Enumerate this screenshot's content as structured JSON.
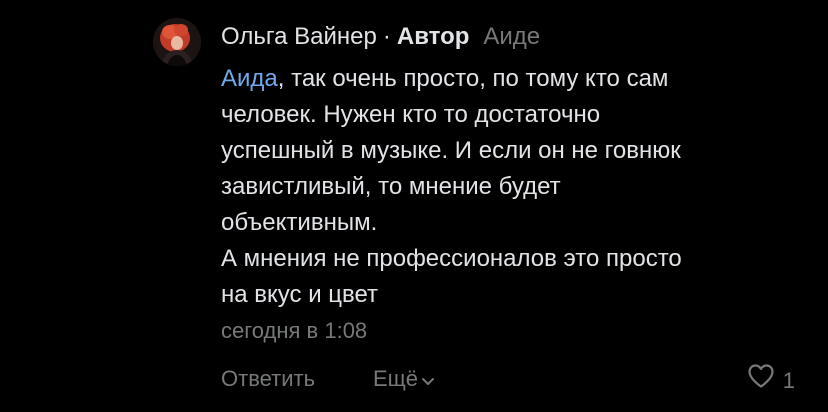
{
  "comment": {
    "author_name": "Ольга Вайнер",
    "separator": "·",
    "author_badge": "Автор",
    "reply_to": "Аиде",
    "mention": "Аида",
    "text_lines": [
      ", так очень просто, по тому кто сам",
      "человек. Нужен кто то достаточно",
      "успешный в музыке. И если он не говнюк",
      "завистливый, то мнение будет",
      "объективным.",
      "А мнения не профессионалов это просто",
      "на вкус и цвет"
    ],
    "timestamp": "сегодня в 1:08"
  },
  "actions": {
    "reply_label": "Ответить",
    "more_label": "Ещё",
    "like_count": "1"
  },
  "icons": {
    "avatar": "avatar",
    "more": "chevron-down-icon",
    "like": "heart-icon"
  },
  "colors": {
    "background": "#000000",
    "text": "#e1e3e6",
    "secondary": "#76787a",
    "link": "#71aaeb"
  }
}
